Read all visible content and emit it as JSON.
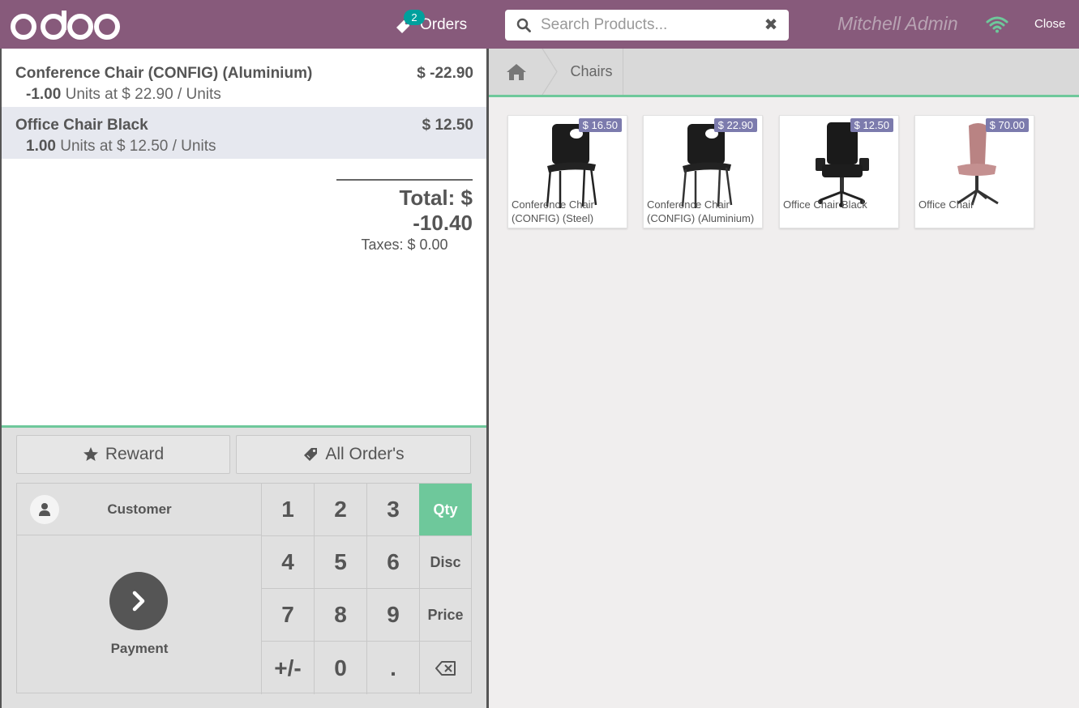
{
  "header": {
    "orders_label": "Orders",
    "orders_count": "2",
    "search_placeholder": "Search Products...",
    "user_name": "Mitchell Admin",
    "close_label": "Close"
  },
  "order": {
    "lines": [
      {
        "name": "Conference Chair (CONFIG) (Aluminium)",
        "price": "$ -22.90",
        "qty": "-1.00",
        "detail": "Units at $ 22.90 / Units"
      },
      {
        "name": "Office Chair Black",
        "price": "$ 12.50",
        "qty": "1.00",
        "detail": "Units at $ 12.50 / Units"
      }
    ],
    "total": "Total: $ -10.40",
    "taxes": "Taxes: $ 0.00"
  },
  "controls": {
    "reward_label": "Reward",
    "all_orders_label": "All Order's",
    "customer_label": "Customer",
    "payment_label": "Payment",
    "keys": [
      "1",
      "2",
      "3",
      "4",
      "5",
      "6",
      "7",
      "8",
      "9",
      "+/-",
      "0",
      "."
    ],
    "modes": [
      "Qty",
      "Disc",
      "Price"
    ],
    "active_mode": "Qty"
  },
  "breadcrumb": {
    "category": "Chairs"
  },
  "products": [
    {
      "price": "$ 16.50",
      "name": "Conference Chair (CONFIG) (Steel)"
    },
    {
      "price": "$ 22.90",
      "name": "Conference Chair (CONFIG) (Aluminium)"
    },
    {
      "price": "$ 12.50",
      "name": "Office Chair Black"
    },
    {
      "price": "$ 70.00",
      "name": "Office Chair"
    }
  ],
  "colors": {
    "brand": "#875a7b",
    "accent": "#6ec89b",
    "badge": "#00a09d",
    "price_tag": "#7c7bad"
  }
}
